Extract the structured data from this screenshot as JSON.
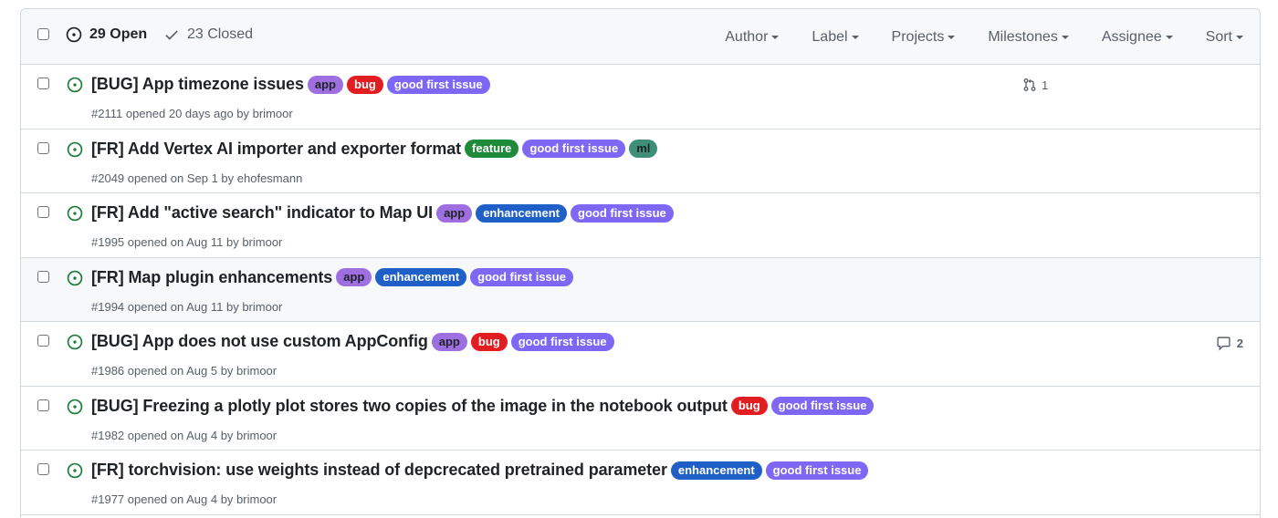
{
  "header": {
    "open_count": "29 Open",
    "closed_count": "23 Closed",
    "filters": [
      "Author",
      "Label",
      "Projects",
      "Milestones",
      "Assignee",
      "Sort"
    ]
  },
  "label_colors": {
    "app": {
      "bg": "#9e6fe0",
      "fg": "#1f2328"
    },
    "bug": {
      "bg": "#e11d21",
      "fg": "#ffffff"
    },
    "good first issue": {
      "bg": "#7f67f5",
      "fg": "#ffffff"
    },
    "feature": {
      "bg": "#1f8b3a",
      "fg": "#ffffff"
    },
    "ml": {
      "bg": "#3f8f78",
      "fg": "#1f2328"
    },
    "enhancement": {
      "bg": "#1e5fc8",
      "fg": "#ffffff"
    }
  },
  "issues": [
    {
      "title": "[BUG] App timezone issues",
      "labels": [
        "app",
        "bug",
        "good first issue"
      ],
      "number": "#2111",
      "opened": " opened 20 days ago by ",
      "author": "brimoor",
      "linked_prs": "1",
      "comments": ""
    },
    {
      "title": "[FR] Add Vertex AI importer and exporter format",
      "labels": [
        "feature",
        "good first issue",
        "ml"
      ],
      "number": "#2049",
      "opened": " opened on Sep 1 by ",
      "author": "ehofesmann",
      "linked_prs": "",
      "comments": ""
    },
    {
      "title": "[FR] Add \"active search\" indicator to Map UI",
      "labels": [
        "app",
        "enhancement",
        "good first issue"
      ],
      "number": "#1995",
      "opened": " opened on Aug 11 by ",
      "author": "brimoor",
      "linked_prs": "",
      "comments": ""
    },
    {
      "title": "[FR] Map plugin enhancements",
      "labels": [
        "app",
        "enhancement",
        "good first issue"
      ],
      "number": "#1994",
      "opened": " opened on Aug 11 by ",
      "author": "brimoor",
      "linked_prs": "",
      "comments": ""
    },
    {
      "title": "[BUG] App does not use custom AppConfig",
      "labels": [
        "app",
        "bug",
        "good first issue"
      ],
      "number": "#1986",
      "opened": " opened on Aug 5 by ",
      "author": "brimoor",
      "linked_prs": "",
      "comments": "2"
    },
    {
      "title": "[BUG] Freezing a plotly plot stores two copies of the image in the notebook output",
      "labels": [
        "bug",
        "good first issue"
      ],
      "number": "#1982",
      "opened": " opened on Aug 4 by ",
      "author": "brimoor",
      "linked_prs": "",
      "comments": ""
    },
    {
      "title": "[FR] torchvision: use weights instead of depcrecated pretrained parameter",
      "labels": [
        "enhancement",
        "good first issue"
      ],
      "number": "#1977",
      "opened": " opened on Aug 4 by ",
      "author": "brimoor",
      "linked_prs": "",
      "comments": ""
    }
  ]
}
